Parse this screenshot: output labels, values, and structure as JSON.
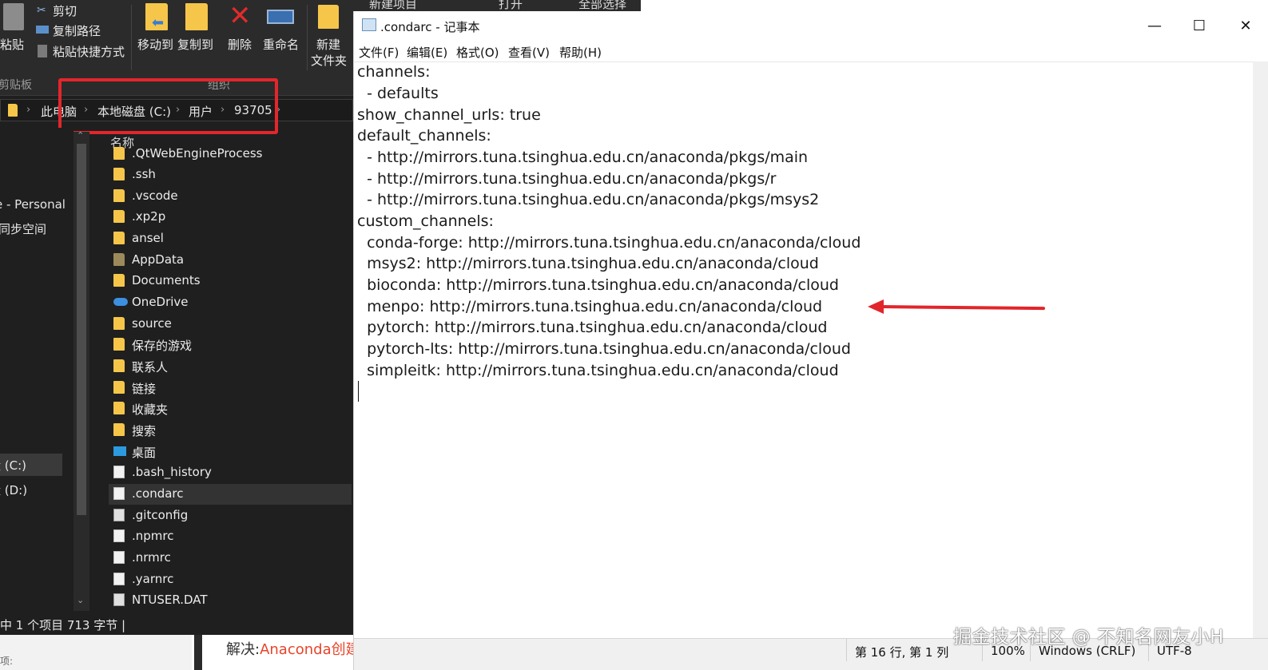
{
  "explorer": {
    "ribbon": {
      "paste_label": "粘贴",
      "cut_label": "剪切",
      "copy_path_label": "复制路径",
      "paste_shortcut_label": "粘贴快捷方式",
      "move_to_label": "移动到",
      "copy_to_label": "复制到",
      "delete_label": "删除",
      "rename_label": "重命名",
      "new_folder_line1": "新建",
      "new_folder_line2": "文件夹",
      "clipboard_group": "剪贴板",
      "organize_group": "组织"
    },
    "breadcrumb": [
      "此电脑",
      "本地磁盘 (C:)",
      "用户",
      "93705"
    ],
    "nav": {
      "item_personal": "e - Personal",
      "item_sync": "同步空间",
      "item_c": "盘 (C:)",
      "item_d": "盘 (D:)"
    },
    "column_name": "名称",
    "files": [
      {
        "name": ".QtWebEngineProcess",
        "type": "folder"
      },
      {
        "name": ".ssh",
        "type": "folder"
      },
      {
        "name": ".vscode",
        "type": "folder"
      },
      {
        "name": ".xp2p",
        "type": "folder"
      },
      {
        "name": "ansel",
        "type": "folder"
      },
      {
        "name": "AppData",
        "type": "folder"
      },
      {
        "name": "Documents",
        "type": "folder"
      },
      {
        "name": "OneDrive",
        "type": "onedrive"
      },
      {
        "name": "source",
        "type": "folder"
      },
      {
        "name": "保存的游戏",
        "type": "folder"
      },
      {
        "name": "联系人",
        "type": "folder"
      },
      {
        "name": "链接",
        "type": "folder"
      },
      {
        "name": "收藏夹",
        "type": "folder"
      },
      {
        "name": "搜索",
        "type": "folder"
      },
      {
        "name": "桌面",
        "type": "desktop"
      },
      {
        "name": ".bash_history",
        "type": "file"
      },
      {
        "name": ".condarc",
        "type": "file",
        "selected": true
      },
      {
        "name": ".gitconfig",
        "type": "sysfile"
      },
      {
        "name": ".npmrc",
        "type": "file"
      },
      {
        "name": ".nrmrc",
        "type": "file"
      },
      {
        "name": ".yarnrc",
        "type": "file"
      },
      {
        "name": "NTUSER.DAT",
        "type": "sysfile"
      }
    ],
    "status": "中 1 个项目  713 字节  |"
  },
  "behind": {
    "top_left": "新建项目",
    "top_mid": "打开",
    "top_right": "全部选择",
    "bottom_prefix": "解决:",
    "bottom_link": "Anaconda创建",
    "bottom_small": "项:"
  },
  "notepad": {
    "title": ".condarc - 记事本",
    "window_controls": {
      "minimize": "—",
      "maximize": "☐",
      "close": "✕"
    },
    "menu": [
      "文件(F)",
      "编辑(E)",
      "格式(O)",
      "查看(V)",
      "帮助(H)"
    ],
    "lines": [
      "channels:",
      "  - defaults",
      "show_channel_urls: true",
      "default_channels:",
      "  - http://mirrors.tuna.tsinghua.edu.cn/anaconda/pkgs/main",
      "  - http://mirrors.tuna.tsinghua.edu.cn/anaconda/pkgs/r",
      "  - http://mirrors.tuna.tsinghua.edu.cn/anaconda/pkgs/msys2",
      "custom_channels:",
      "  conda-forge: http://mirrors.tuna.tsinghua.edu.cn/anaconda/cloud",
      "  msys2: http://mirrors.tuna.tsinghua.edu.cn/anaconda/cloud",
      "  bioconda: http://mirrors.tuna.tsinghua.edu.cn/anaconda/cloud",
      "  menpo: http://mirrors.tuna.tsinghua.edu.cn/anaconda/cloud",
      "  pytorch: http://mirrors.tuna.tsinghua.edu.cn/anaconda/cloud",
      "  pytorch-lts: http://mirrors.tuna.tsinghua.edu.cn/anaconda/cloud",
      "  simpleitk: http://mirrors.tuna.tsinghua.edu.cn/anaconda/cloud"
    ],
    "status": {
      "position": "第 16 行, 第 1 列",
      "zoom": "100%",
      "line_ending": "Windows (CRLF)",
      "encoding": "UTF-8"
    }
  },
  "watermark": "掘金技术社区 @ 不知名网友小H",
  "colors": {
    "annotation_red": "#e2252b",
    "explorer_bg": "#1f1f1f",
    "folder_yellow": "#f5c64a"
  }
}
